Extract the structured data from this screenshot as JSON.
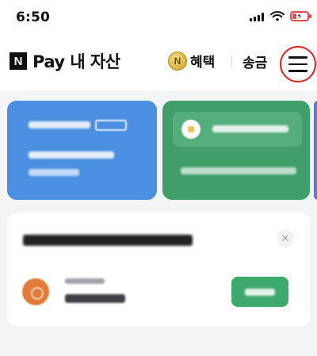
{
  "status_bar": {
    "time": "6:50",
    "signal_icon": "cellular-signal-icon",
    "wifi_icon": "wifi-icon",
    "battery_icon": "battery-charging-low-icon",
    "battery_color": "#e5484d"
  },
  "header": {
    "logo_letter": "N",
    "title": "Pay 내 자산",
    "benefit_coin_letter": "N",
    "benefit_label": "혜택",
    "send_label": "송금",
    "menu_icon": "hamburger-menu-icon",
    "menu_highlight_color": "#e02424"
  },
  "asset_cards": [
    {
      "name": "blurred-card-blue",
      "color": "#4a8fe0"
    },
    {
      "name": "blurred-card-green",
      "color": "#3f9e6a"
    }
  ],
  "promo_card": {
    "close_icon": "close-icon",
    "close_glyph": "✕",
    "action_color": "#3ea96d"
  }
}
